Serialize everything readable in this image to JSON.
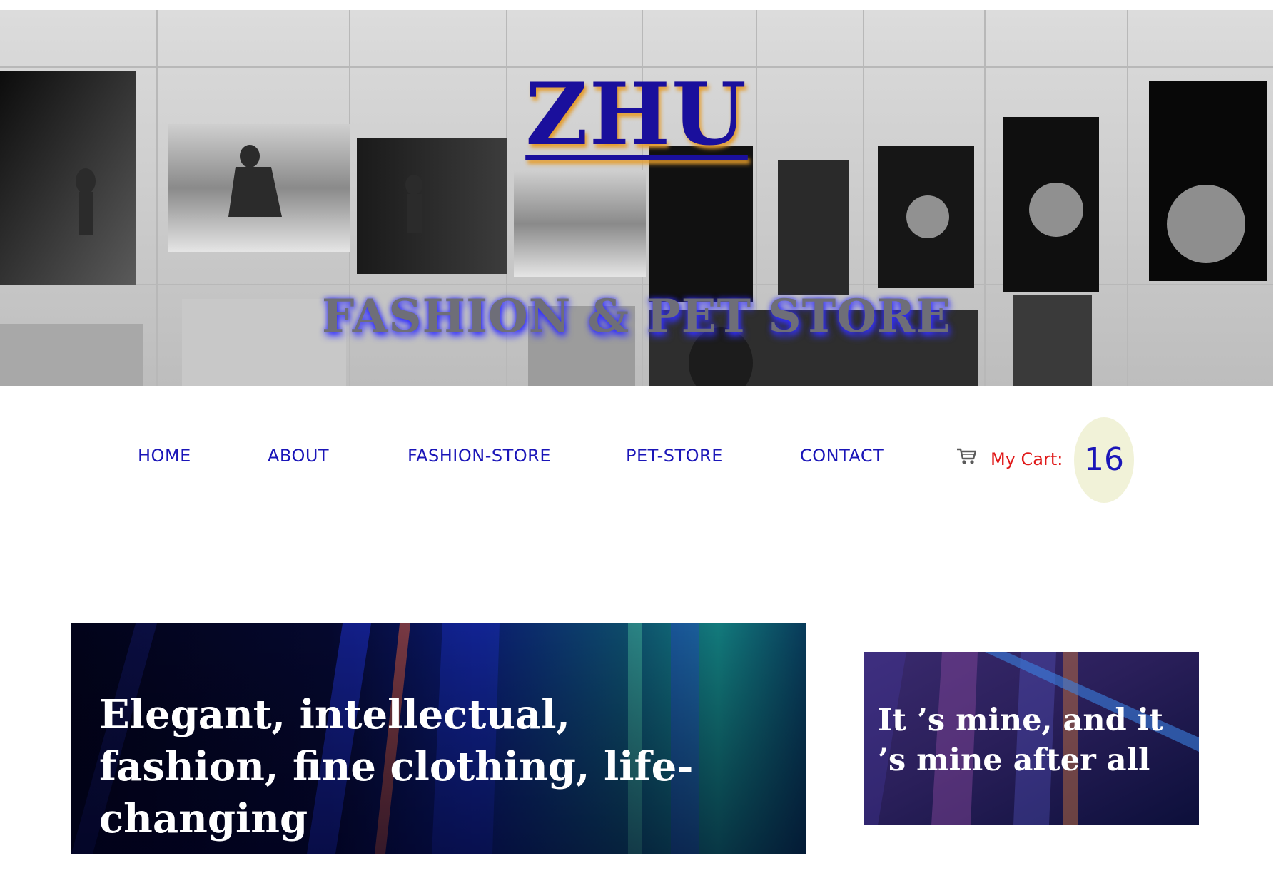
{
  "hero": {
    "title": "ZHU",
    "subtitle": "FASHION & PET STORE"
  },
  "nav": {
    "items": [
      {
        "label": "HOME"
      },
      {
        "label": "ABOUT"
      },
      {
        "label": "FASHION-STORE"
      },
      {
        "label": "PET-STORE"
      },
      {
        "label": "CONTACT"
      }
    ],
    "cart": {
      "icon": "shopping-cart-icon",
      "label": "My Cart:",
      "count": "16"
    }
  },
  "banners": {
    "main": {
      "text": "Elegant, intellectual, fashion, fine clothing, life-changing"
    },
    "side": {
      "text": "It ’s mine, and it ’s mine after all"
    }
  },
  "colors": {
    "title": "#1a0f9c",
    "nav_link": "#1a15b8",
    "cart_label": "#e01818",
    "cart_badge_bg": "#f1f2d8"
  }
}
